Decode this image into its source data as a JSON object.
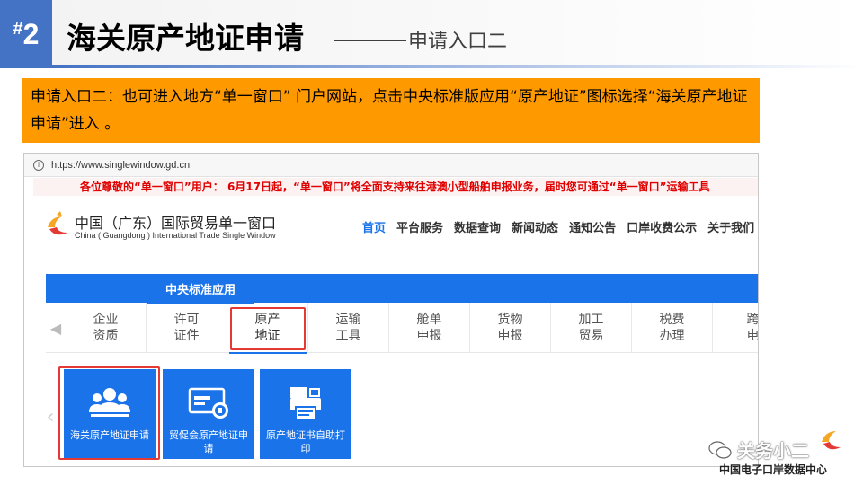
{
  "header": {
    "badge_hash": "#",
    "badge_number": "2",
    "title": "海关原产地证申请",
    "subtitle": "申请入口二"
  },
  "note": {
    "text": "申请入口二：也可进入地方“单一窗口” 门户网站，点击中央标准版应用“原产地证”图标选择“海关原产地证申请”进入 。"
  },
  "browser": {
    "url": "https://www.singlewindow.gd.cn",
    "ticker": "各位尊敬的“单一窗口”用户： 6月17日起，“单一窗口”将全面支持来往港澳小型船舶申报业务，届时您可通过“单一窗口”运输工具"
  },
  "site": {
    "name_cn": "中国（广东）国际贸易单一窗口",
    "name_en": "China ( Guangdong ) International Trade Single Window",
    "nav": [
      "首页",
      "平台服务",
      "数据查询",
      "新闻动态",
      "通知公告",
      "口岸收费公示",
      "关于我们"
    ],
    "active_nav": "首页"
  },
  "tab": {
    "label": "中央标准应用"
  },
  "categories": [
    "企业\n资质",
    "许可\n证件",
    "原产\n地证",
    "运输\n工具",
    "舱单\n申报",
    "货物\n申报",
    "加工\n贸易",
    "税费\n办理",
    "跨\n电"
  ],
  "active_category": "原产\n地证",
  "apps": [
    {
      "label": "海关原产地证申请",
      "icon": "users-icon"
    },
    {
      "label": "贸促会原产地证申请",
      "icon": "certificate-icon"
    },
    {
      "label": "原产地证书自助打印",
      "icon": "printer-icon"
    }
  ],
  "watermark": {
    "main": "关务小二",
    "sub": "中国电子口岸数据中心"
  },
  "colors": {
    "accent_blue": "#4472c4",
    "site_blue": "#1a73e8",
    "note_orange": "#ff9900",
    "highlight_red": "#e53935",
    "ticker_red": "#e00000"
  }
}
